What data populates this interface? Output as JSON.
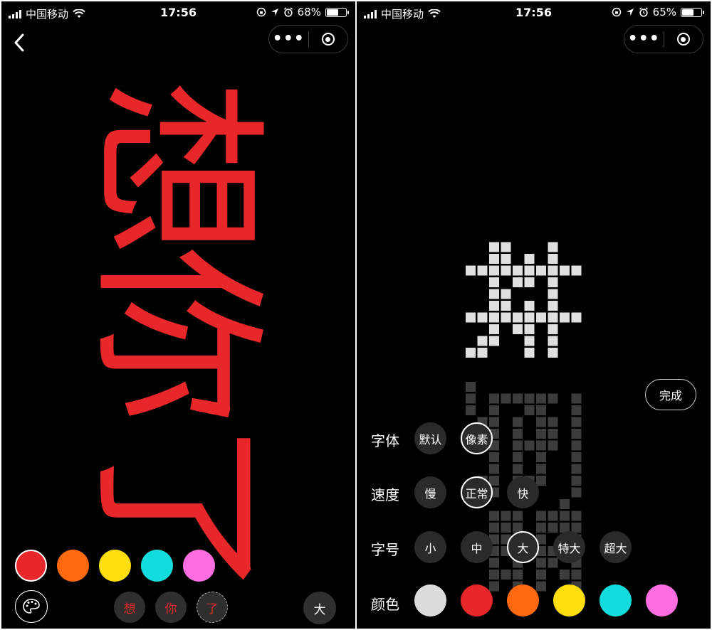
{
  "status_left": {
    "carrier": "中国移动",
    "time": "17:56",
    "battery": "68%",
    "battery_level": 0.68
  },
  "status_right": {
    "carrier": "中国移动",
    "time": "17:56",
    "battery": "65%",
    "battery_level": 0.65
  },
  "left_screen": {
    "marquee_text": [
      "想",
      "你",
      "了"
    ],
    "marquee_color": "#e8272a",
    "colors": [
      {
        "name": "red",
        "hex": "#e8272a",
        "selected": true
      },
      {
        "name": "orange",
        "hex": "#ff6a10"
      },
      {
        "name": "yellow",
        "hex": "#ffde0f"
      },
      {
        "name": "cyan",
        "hex": "#12dcdc"
      },
      {
        "name": "pink",
        "hex": "#ff6ee0"
      }
    ],
    "char_chips": [
      "想",
      "你",
      "了"
    ],
    "size_label": "大",
    "palette_icon": "palette-icon"
  },
  "right_screen": {
    "done_label": "完成",
    "font": {
      "label": "字体",
      "options": [
        "默认",
        "像素"
      ],
      "selected": "像素"
    },
    "speed": {
      "label": "速度",
      "options": [
        "慢",
        "正常",
        "快"
      ],
      "selected": "正常"
    },
    "size": {
      "label": "字号",
      "options": [
        "小",
        "中",
        "大",
        "特大",
        "超大"
      ],
      "selected": "大"
    },
    "color": {
      "label": "颜色",
      "options": [
        "#dcdcdc",
        "#e8272a",
        "#ff6a10",
        "#ffde0f",
        "#12dcdc",
        "#ff6ee0"
      ]
    }
  }
}
